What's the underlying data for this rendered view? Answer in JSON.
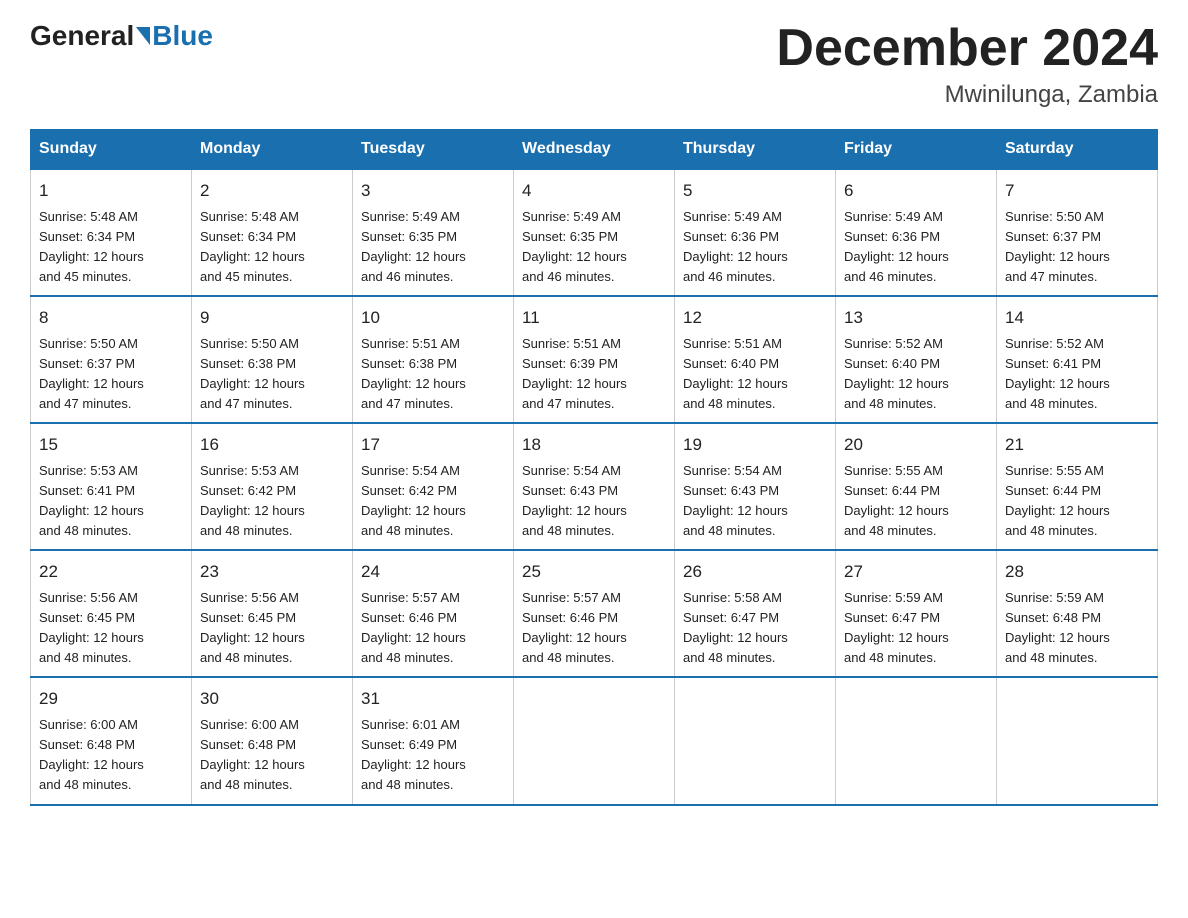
{
  "header": {
    "logo_general": "General",
    "logo_blue": "Blue",
    "title": "December 2024",
    "subtitle": "Mwinilunga, Zambia"
  },
  "days_of_week": [
    "Sunday",
    "Monday",
    "Tuesday",
    "Wednesday",
    "Thursday",
    "Friday",
    "Saturday"
  ],
  "weeks": [
    [
      {
        "day": "1",
        "sunrise": "5:48 AM",
        "sunset": "6:34 PM",
        "daylight": "12 hours and 45 minutes."
      },
      {
        "day": "2",
        "sunrise": "5:48 AM",
        "sunset": "6:34 PM",
        "daylight": "12 hours and 45 minutes."
      },
      {
        "day": "3",
        "sunrise": "5:49 AM",
        "sunset": "6:35 PM",
        "daylight": "12 hours and 46 minutes."
      },
      {
        "day": "4",
        "sunrise": "5:49 AM",
        "sunset": "6:35 PM",
        "daylight": "12 hours and 46 minutes."
      },
      {
        "day": "5",
        "sunrise": "5:49 AM",
        "sunset": "6:36 PM",
        "daylight": "12 hours and 46 minutes."
      },
      {
        "day": "6",
        "sunrise": "5:49 AM",
        "sunset": "6:36 PM",
        "daylight": "12 hours and 46 minutes."
      },
      {
        "day": "7",
        "sunrise": "5:50 AM",
        "sunset": "6:37 PM",
        "daylight": "12 hours and 47 minutes."
      }
    ],
    [
      {
        "day": "8",
        "sunrise": "5:50 AM",
        "sunset": "6:37 PM",
        "daylight": "12 hours and 47 minutes."
      },
      {
        "day": "9",
        "sunrise": "5:50 AM",
        "sunset": "6:38 PM",
        "daylight": "12 hours and 47 minutes."
      },
      {
        "day": "10",
        "sunrise": "5:51 AM",
        "sunset": "6:38 PM",
        "daylight": "12 hours and 47 minutes."
      },
      {
        "day": "11",
        "sunrise": "5:51 AM",
        "sunset": "6:39 PM",
        "daylight": "12 hours and 47 minutes."
      },
      {
        "day": "12",
        "sunrise": "5:51 AM",
        "sunset": "6:40 PM",
        "daylight": "12 hours and 48 minutes."
      },
      {
        "day": "13",
        "sunrise": "5:52 AM",
        "sunset": "6:40 PM",
        "daylight": "12 hours and 48 minutes."
      },
      {
        "day": "14",
        "sunrise": "5:52 AM",
        "sunset": "6:41 PM",
        "daylight": "12 hours and 48 minutes."
      }
    ],
    [
      {
        "day": "15",
        "sunrise": "5:53 AM",
        "sunset": "6:41 PM",
        "daylight": "12 hours and 48 minutes."
      },
      {
        "day": "16",
        "sunrise": "5:53 AM",
        "sunset": "6:42 PM",
        "daylight": "12 hours and 48 minutes."
      },
      {
        "day": "17",
        "sunrise": "5:54 AM",
        "sunset": "6:42 PM",
        "daylight": "12 hours and 48 minutes."
      },
      {
        "day": "18",
        "sunrise": "5:54 AM",
        "sunset": "6:43 PM",
        "daylight": "12 hours and 48 minutes."
      },
      {
        "day": "19",
        "sunrise": "5:54 AM",
        "sunset": "6:43 PM",
        "daylight": "12 hours and 48 minutes."
      },
      {
        "day": "20",
        "sunrise": "5:55 AM",
        "sunset": "6:44 PM",
        "daylight": "12 hours and 48 minutes."
      },
      {
        "day": "21",
        "sunrise": "5:55 AM",
        "sunset": "6:44 PM",
        "daylight": "12 hours and 48 minutes."
      }
    ],
    [
      {
        "day": "22",
        "sunrise": "5:56 AM",
        "sunset": "6:45 PM",
        "daylight": "12 hours and 48 minutes."
      },
      {
        "day": "23",
        "sunrise": "5:56 AM",
        "sunset": "6:45 PM",
        "daylight": "12 hours and 48 minutes."
      },
      {
        "day": "24",
        "sunrise": "5:57 AM",
        "sunset": "6:46 PM",
        "daylight": "12 hours and 48 minutes."
      },
      {
        "day": "25",
        "sunrise": "5:57 AM",
        "sunset": "6:46 PM",
        "daylight": "12 hours and 48 minutes."
      },
      {
        "day": "26",
        "sunrise": "5:58 AM",
        "sunset": "6:47 PM",
        "daylight": "12 hours and 48 minutes."
      },
      {
        "day": "27",
        "sunrise": "5:59 AM",
        "sunset": "6:47 PM",
        "daylight": "12 hours and 48 minutes."
      },
      {
        "day": "28",
        "sunrise": "5:59 AM",
        "sunset": "6:48 PM",
        "daylight": "12 hours and 48 minutes."
      }
    ],
    [
      {
        "day": "29",
        "sunrise": "6:00 AM",
        "sunset": "6:48 PM",
        "daylight": "12 hours and 48 minutes."
      },
      {
        "day": "30",
        "sunrise": "6:00 AM",
        "sunset": "6:48 PM",
        "daylight": "12 hours and 48 minutes."
      },
      {
        "day": "31",
        "sunrise": "6:01 AM",
        "sunset": "6:49 PM",
        "daylight": "12 hours and 48 minutes."
      },
      {
        "day": "",
        "sunrise": "",
        "sunset": "",
        "daylight": ""
      },
      {
        "day": "",
        "sunrise": "",
        "sunset": "",
        "daylight": ""
      },
      {
        "day": "",
        "sunrise": "",
        "sunset": "",
        "daylight": ""
      },
      {
        "day": "",
        "sunrise": "",
        "sunset": "",
        "daylight": ""
      }
    ]
  ],
  "labels": {
    "sunrise": "Sunrise:",
    "sunset": "Sunset:",
    "daylight": "Daylight:"
  }
}
